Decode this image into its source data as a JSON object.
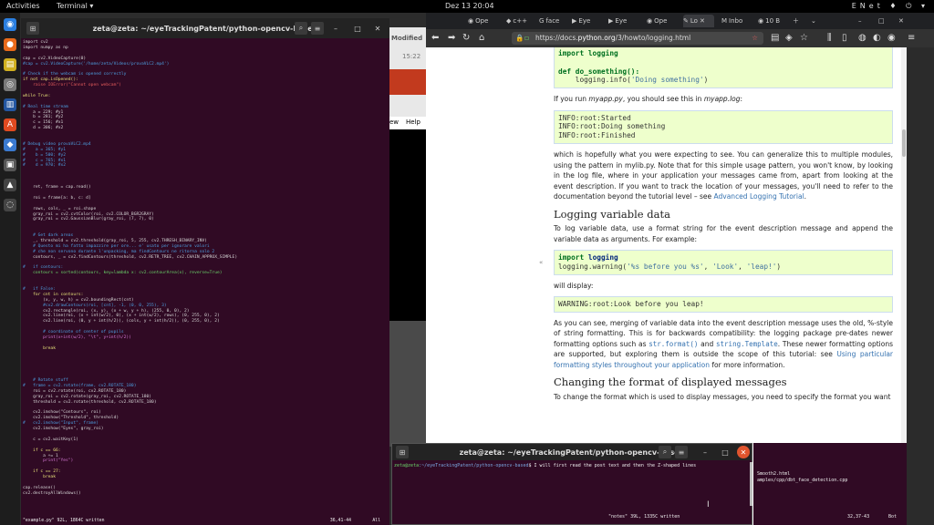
{
  "topbar": {
    "activities": "Activities",
    "app": "Terminal ▾",
    "clock": "Dez 13  20:04",
    "tray": "ENet ♦ ⏻ ▾"
  },
  "behind": {
    "modified": "Modified",
    "time": "15:22",
    "menu_view": "ew",
    "menu_help": "Help"
  },
  "term1": {
    "title": "zeta@zeta: ~/eyeTrackingPatent/python-opencv-based",
    "status_left": "\"example.py\" 92L, 1864C written",
    "status_pos": "36,41-44",
    "status_pct": "All"
  },
  "code_lines": [
    [
      "kw",
      "import cv2"
    ],
    [
      "kw",
      "import numpy as np"
    ],
    [
      "",
      ""
    ],
    [
      "kw",
      "cap = cv2.VideoCapture(0)"
    ],
    [
      "cm",
      "#cap = cv2.VideoCapture('/home/zeta/Videos/provaVLC2.mp4')"
    ],
    [
      "",
      ""
    ],
    [
      "cm",
      "# Check if the webcam is opened correctly"
    ],
    [
      "yl",
      "if not cap.isOpened():"
    ],
    [
      "rd",
      "    raise IOError(\"Cannot open webcam\")"
    ],
    [
      "",
      ""
    ],
    [
      "yl",
      "while True:"
    ],
    [
      "",
      ""
    ],
    [
      "cm",
      "# Real time stream"
    ],
    [
      "kw",
      "    a = 229; #y1"
    ],
    [
      "kw",
      "    b = 281; #y2"
    ],
    [
      "kw",
      "    c = 156; #x1"
    ],
    [
      "kw",
      "    d = 306; #x2"
    ],
    [
      "",
      ""
    ],
    [
      "",
      ""
    ],
    [
      "cm",
      "# Debug video provaVLC2.mp4"
    ],
    [
      "cm",
      "#    a = 365; #y1"
    ],
    [
      "cm",
      "#    b = 500; #y2"
    ],
    [
      "cm",
      "#    c = 765; #x1"
    ],
    [
      "cm",
      "#    d = 970; #x2"
    ],
    [
      "",
      ""
    ],
    [
      "",
      ""
    ],
    [
      "",
      ""
    ],
    [
      "kw",
      "    ret, frame = cap.read()"
    ],
    [
      "",
      ""
    ],
    [
      "kw",
      "    roi = frame[a: b, c: d]"
    ],
    [
      "",
      ""
    ],
    [
      "kw",
      "    rows, cols, _ = roi.shape"
    ],
    [
      "kw",
      "    gray_roi = cv2.cvtColor(roi, cv2.COLOR_BGR2GRAY)"
    ],
    [
      "kw",
      "    gray_roi = cv2.GaussianBlur(gray_roi, (7, 7), 0)"
    ],
    [
      "",
      ""
    ],
    [
      "",
      ""
    ],
    [
      "cm",
      "    # Get dark areas"
    ],
    [
      "kw",
      "    _, threshold = cv2.threshold(gray_roi, 5, 255, cv2.THRESH_BINARY_INV)"
    ],
    [
      "cm",
      "    # Questo mi ha fatto impazzire per ore... e' usato per ignorare valori"
    ],
    [
      "cm",
      "    # che non servono durante l'unpacking, ma findContours ne ritorna solo 2"
    ],
    [
      "kw",
      "    contours, _ = cv2.findContours(threshold, cv2.RETR_TREE, cv2.CHAIN_APPROX_SIMPLE)"
    ],
    [
      "",
      ""
    ],
    [
      "cm",
      "#   if contours:"
    ],
    [
      "gr",
      "    contours = sorted(contours, key=lambda x: cv2.contourArea(x), reverse=True)"
    ],
    [
      "",
      ""
    ],
    [
      "",
      ""
    ],
    [
      "cm",
      "#   if False:"
    ],
    [
      "yl",
      "    for cnt in contours:"
    ],
    [
      "kw",
      "        (x, y, w, h) = cv2.boundingRect(cnt)"
    ],
    [
      "cm",
      "        #cv2.drawContours(roi, [cnt], -1, (0, 0, 255), 3)"
    ],
    [
      "kw",
      "        cv2.rectangle(roi, (x, y), (x + w, y + h), (255, 0, 0), 2)"
    ],
    [
      "kw",
      "        cv2.line(roi, (x + int(w/2), 0), (x + int(w/2), rows), (0, 255, 0), 2)"
    ],
    [
      "kw",
      "        cv2.line(roi, (0, y + int(h/2)), (cols, y + int(h/2)), (0, 255, 0), 2)"
    ],
    [
      "",
      ""
    ],
    [
      "cm",
      "        # coordinate of center of pupils"
    ],
    [
      "mg",
      "        print(x+int(w/2), \"\\t\", y+int(h/2))"
    ],
    [
      "",
      ""
    ],
    [
      "yl",
      "        break"
    ],
    [
      "",
      ""
    ],
    [
      "",
      ""
    ],
    [
      "",
      ""
    ],
    [
      "",
      ""
    ],
    [
      "",
      ""
    ],
    [
      "cm",
      "    # Rotate stuff"
    ],
    [
      "cm",
      "#   frame = cv2.rotate(frame, cv2.ROTATE_180)"
    ],
    [
      "kw",
      "    roi = cv2.rotate(roi, cv2.ROTATE_180)"
    ],
    [
      "kw",
      "    gray_roi = cv2.rotate(gray_roi, cv2.ROTATE_180)"
    ],
    [
      "kw",
      "    threshold = cv2.rotate(threshold, cv2.ROTATE_180)"
    ],
    [
      "",
      ""
    ],
    [
      "kw",
      "    cv2.imshow(\"Contours\", roi)"
    ],
    [
      "kw",
      "    cv2.imshow(\"Threshold\", threshold)"
    ],
    [
      "cm",
      "#   cv2.imshow(\"Input\", frame)"
    ],
    [
      "kw",
      "    cv2.imshow(\"Eyes\", gray_roi)"
    ],
    [
      "",
      ""
    ],
    [
      "kw",
      "    c = cv2.waitKey(1)"
    ],
    [
      "",
      ""
    ],
    [
      "yl",
      "    if c == 66:"
    ],
    [
      "kw",
      "        a += 1"
    ],
    [
      "mg",
      "        print(\"Yes\")"
    ],
    [
      "",
      ""
    ],
    [
      "yl",
      "    if c == 27:"
    ],
    [
      "yl",
      "        break"
    ],
    [
      "",
      ""
    ],
    [
      "kw",
      "cap.release()"
    ],
    [
      "kw",
      "cv2.destroyAllWindows()"
    ]
  ],
  "browser": {
    "tabs": [
      "Ope",
      "c++",
      "face",
      "Eye",
      "Eye",
      "Ope",
      "Lo",
      "Inbo",
      "10 B"
    ],
    "url_prefix": "https://docs.",
    "url_domain": "python.org",
    "url_path": "/3/howto/logging.html"
  },
  "doc": {
    "code1_l1": "import logging",
    "code1_l2": "def do_something():",
    "code1_l3a": "    logging.info(",
    "code1_l3b": "'Doing something'",
    "code1_l3c": ")",
    "p1a": "If you run ",
    "p1b": "myapp.py",
    "p1c": ", you should see this in ",
    "p1d": "myapp.log",
    "p1e": ":",
    "out1": "INFO:root:Started\nINFO:root:Doing something\nINFO:root:Finished",
    "p2": "which is hopefully what you were expecting to see. You can generalize this to multiple modules, using the pattern in mylib.py. Note that for this simple usage pattern, you won't know, by looking in the log file, where in your application your messages came from, apart from looking at the event description. If you want to track the location of your messages, you'll need to refer to the documentation beyond the tutorial level – see ",
    "p2_link": "Advanced Logging Tutorial",
    "p2_end": ".",
    "h1": "Logging variable data",
    "p3": "To log variable data, use a format string for the event description message and append the variable data as arguments. For example:",
    "code2_kw": "import",
    "code2_mod": "logging",
    "code2_l2a": "logging.warning(",
    "code2_s1": "'%s before you %s'",
    "code2_sep1": ", ",
    "code2_s2": "'Look'",
    "code2_sep2": ", ",
    "code2_s3": "'leap!'",
    "code2_end": ")",
    "p4": "will display:",
    "out2": "WARNING:root:Look before you leap!",
    "p5a": "As you can see, merging of variable data into the event description message uses the old, %-style of string formatting. This is for backwards compatibility: the logging package pre-dates newer formatting options such as ",
    "p5_lit1": "str.format()",
    "p5b": " and ",
    "p5_lit2": "string.Template",
    "p5c": ". These newer formatting options are supported, but exploring them is outside the scope of this tutorial: see ",
    "p5_link": "Using particular formatting styles throughout your application",
    "p5d": " for more information.",
    "h2": "Changing the format of displayed messages",
    "p6": "To change the format which is used to display messages, you need to specify the format you want"
  },
  "term2": {
    "title": "zeta@zeta: ~/eyeTrackingPatent/python-opencv-based",
    "prompt_user": "zeta@zeta",
    "prompt_path": ":~/eyeTrackingPatent/python-opencv-based",
    "prompt_cmd": "$ I will first read the post text and then the Z-shaped lines"
  },
  "vim2": {
    "line1": "Smooth2.html",
    "line2": "amples/cpp/dbt_face_detection.cpp",
    "status": "\"notes\" 39L, 1335C written",
    "pos": "32,37-43",
    "pct": "Bot"
  },
  "colors": {
    "terminal_bg": "#300a24",
    "code_bg": "#eeffcc",
    "link": "#3572b0"
  }
}
